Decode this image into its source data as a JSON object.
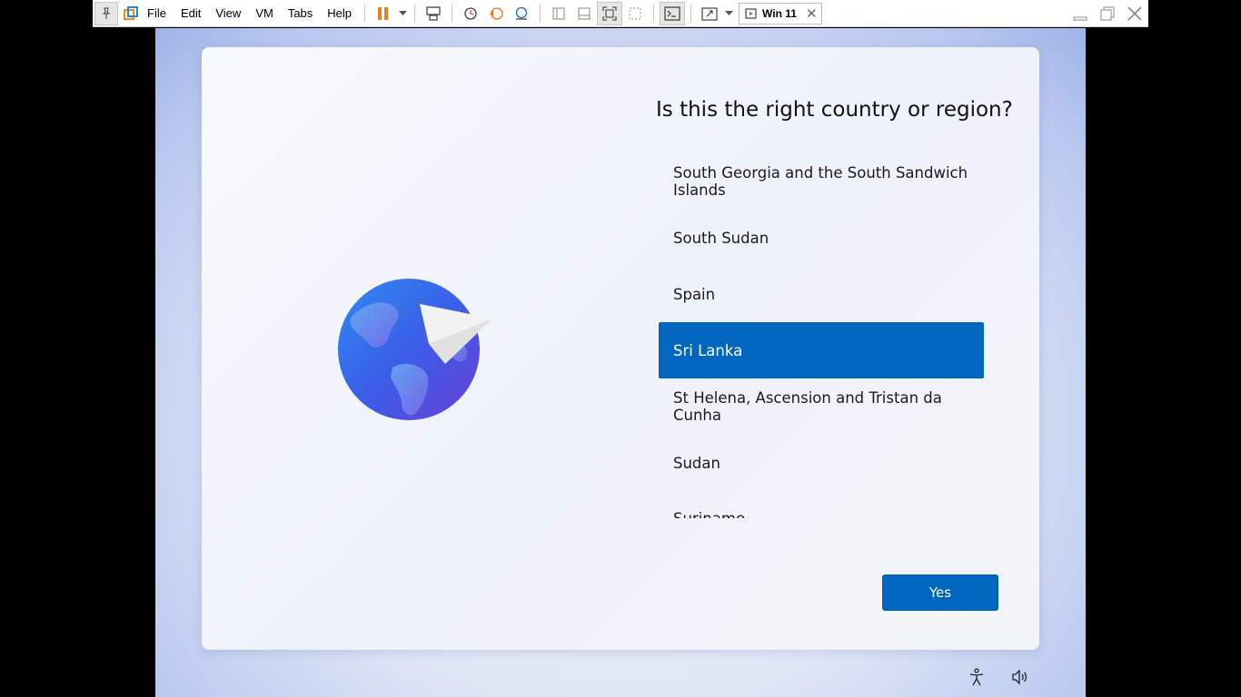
{
  "toolbar": {
    "menus": [
      "File",
      "Edit",
      "View",
      "VM",
      "Tabs",
      "Help"
    ],
    "tab_title": "Win 11",
    "tab_close": "✕"
  },
  "setup": {
    "question": "Is this the right country or region?",
    "regions": [
      "South Georgia and the South Sandwich Islands",
      "South Sudan",
      "Spain",
      "Sri Lanka",
      "St Helena, Ascension and Tristan da Cunha",
      "Sudan",
      "Suriname"
    ],
    "selected": "Sri Lanka",
    "yes_label": "Yes"
  },
  "colors": {
    "accent": "#0067c0",
    "pause_orange": "#f07c1b"
  }
}
